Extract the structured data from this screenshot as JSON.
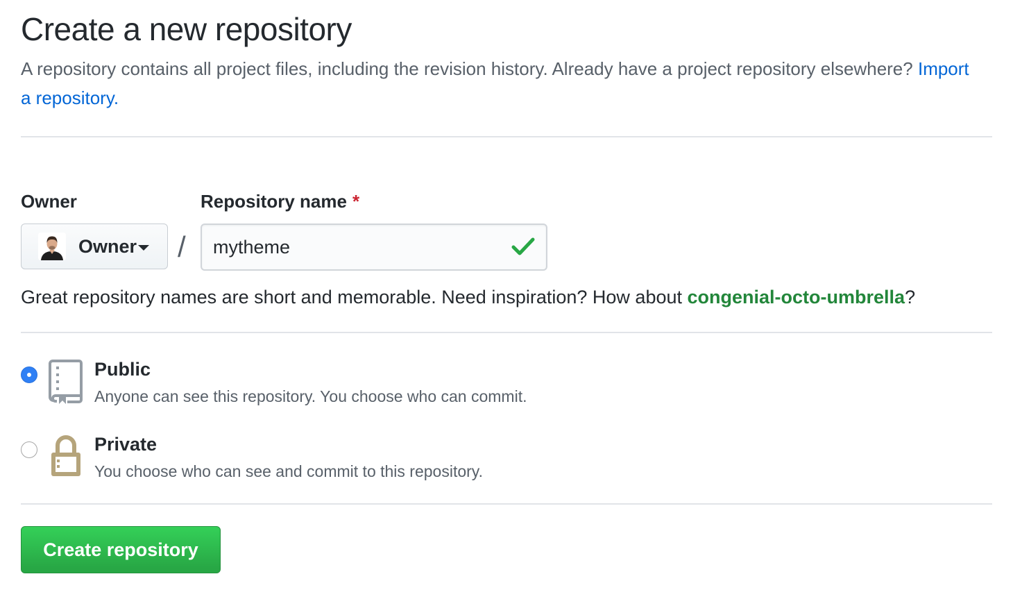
{
  "header": {
    "title": "Create a new repository",
    "subtitle": "A repository contains all project files, including the revision history. Already have a project repository elsewhere?",
    "import_link": "Import a repository."
  },
  "owner": {
    "label": "Owner",
    "selected": "Owner",
    "avatar_icon": "user-avatar"
  },
  "repo_name": {
    "label": "Repository name",
    "required_mark": "*",
    "separator": "/",
    "value": "mytheme",
    "valid_icon": "check-icon"
  },
  "hint": {
    "text": "Great repository names are short and memorable. Need inspiration? How about",
    "suggestion": "congenial-octo-umbrella",
    "end": "?"
  },
  "visibility": {
    "options": [
      {
        "title": "Public",
        "description": "Anyone can see this repository. You choose who can commit.",
        "icon": "repo-icon",
        "checked": true
      },
      {
        "title": "Private",
        "description": "You choose who can see and commit to this repository.",
        "icon": "lock-icon",
        "checked": false
      }
    ]
  },
  "actions": {
    "create_label": "Create repository"
  },
  "colors": {
    "link": "#0366d6",
    "suggestion": "#22863a",
    "required": "#cb2431",
    "create_button": "#2ea44f",
    "radio_checked": "#2f80f5"
  }
}
